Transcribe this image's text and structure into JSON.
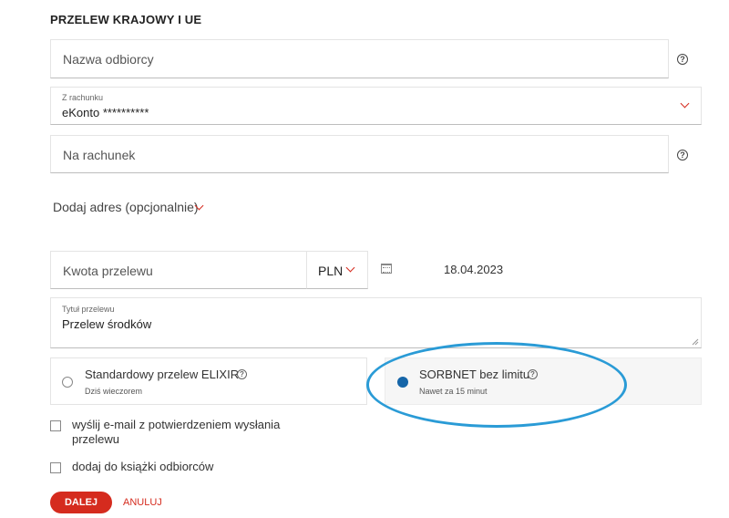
{
  "form": {
    "title": "PRZELEW KRAJOWY I UE",
    "recipient_name_placeholder": "Nazwa odbiorcy",
    "from_account": {
      "label": "Z rachunku",
      "value": "eKonto **********"
    },
    "to_account_placeholder": "Na rachunek",
    "add_address": "Dodaj adres (opcjonalnie)",
    "amount_placeholder": "Kwota przelewu",
    "currency": "PLN",
    "date": "18.04.2023",
    "transfer_title": {
      "label": "Tytuł przelewu",
      "value": "Przelew środków"
    },
    "help_glyph": "?"
  },
  "transfer_types": [
    {
      "title": "Standardowy przelew ELIXIR",
      "subtitle": "Dziś wieczorem",
      "selected": false
    },
    {
      "title": "SORBNET bez limitu",
      "subtitle": "Nawet za 15 minut",
      "selected": true
    }
  ],
  "options": {
    "email_confirmation": "wyślij e-mail z potwierdzeniem wysłania przelewu",
    "add_to_address_book": "dodaj do książki odbiorców"
  },
  "actions": {
    "next": "DALEJ",
    "cancel": "ANULUJ"
  },
  "colors": {
    "accent": "#d52b1e",
    "radio_selected": "#1565a8",
    "highlight_ellipse": "#2a9bd6"
  }
}
